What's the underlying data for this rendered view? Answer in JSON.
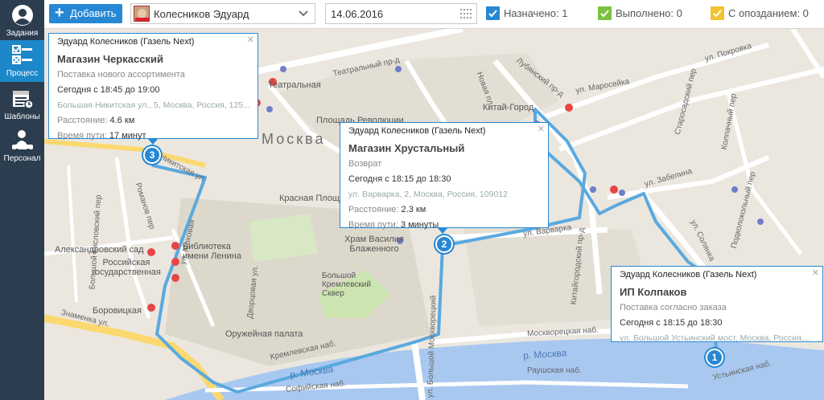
{
  "sidebar": {
    "items": [
      {
        "label": "Задания",
        "icon": "user-circle-icon"
      },
      {
        "label": "Процесс",
        "icon": "checklist-icon"
      },
      {
        "label": "Шаблоны",
        "icon": "calendar-list-icon"
      },
      {
        "label": "Персонал",
        "icon": "person-car-icon"
      }
    ]
  },
  "toolbar": {
    "add_label": "Добавить",
    "driver_name": "Колесников Эдуард",
    "date_value": "14.06.2016",
    "statuses": [
      {
        "label": "Назначено: 1",
        "color": "#2688d4"
      },
      {
        "label": "Выполнено: 0",
        "color": "#7cc142"
      },
      {
        "label": "С опозданием: 0",
        "color": "#f2c230"
      }
    ]
  },
  "map": {
    "labels": {
      "city": "Москва",
      "teatralny_pr": "Театральный пр-д",
      "teatralnaya": "Театральная",
      "ploshchad_revolyutsii": "Площадь Революции",
      "nikitskaya": "Никитская ул.",
      "mokhovaya": "ул. Моховая",
      "krasnaya_ploshchad": "Красная Площадь",
      "aleksandrovsky_sad": "Александровский сад",
      "rossiyskaya_gos": "Российская государственная",
      "biblioteka": "Библиотека имени Ленина",
      "borovitskaya": "Боровицкая",
      "znamenka": "Знаменка ул.",
      "khram": "Храм Василия Блаженного",
      "bolshoy_skver": "Большой Кремлевский Сквер",
      "oruzheynaya": "Оружейная палата",
      "kremlevskaya_nab": "Кремлевская наб.",
      "moskva_river": "р. Москва",
      "moskva_river2": "р. Москва",
      "sofiyskaya": "Софийская наб.",
      "moskvoretskaya": "Москворецкая наб.",
      "raushskaya": "Раушская наб.",
      "kitay_gorod": "Китай-Город",
      "lubyansky": "Лубянский пр-д",
      "maroseyka": "ул. Маросейка",
      "pokrovka": "ул. Покровка",
      "varvarka": "ул. Варварка",
      "zabelina": "ул. Забелина",
      "solyanka": "ул. Солянка",
      "ustinsky": "Устьинская наб.",
      "kitaygorodsky": "Китайгородский пр-д",
      "bolshoy_moskvoretsky": "ул. Большой Москворецкий",
      "novaya_pl": "Новая пл.",
      "romanov": "Романов пер",
      "bkislovsky": "Большой Кисловский пер",
      "kolpachny": "Колпачный пер",
      "podkolokolny": "Подколокольный пер",
      "starosadsky": "Старосадский пер",
      "dvortsovaya": "Дворцовая ул."
    },
    "stops": [
      {
        "number": "3",
        "driver": "Эдуард Колесников (Газель Next)",
        "title": "Магазин Черкасский",
        "type": "Поставка нового ассортимента",
        "time": "Сегодня с 18:45 до 19:00",
        "address": "Большая Никитская ул., 5, Москва, Россия, 125...",
        "distance_label": "Расстояние:",
        "distance": "4.6 км",
        "travel_label": "Время пути:",
        "travel": "17 минут"
      },
      {
        "number": "2",
        "driver": "Эдуард Колесников (Газель Next)",
        "title": "Магазин Хрустальный",
        "type": "Возврат",
        "time": "Сегодня с 18:15 до 18:30",
        "address": "ул. Варварка, 2, Москва, Россия, 109012",
        "distance_label": "Расстояние:",
        "distance": "2.3 км",
        "travel_label": "Время пути:",
        "travel": "3 минуты"
      },
      {
        "number": "1",
        "driver": "Эдуард Колесников (Газель Next)",
        "title": "ИП Колпаков",
        "type": "Поставка согласно заказа",
        "time": "Сегодня с 18:15 до 18:30",
        "address": "ул. Большой Устьинский мост, Москва, Россия,..."
      }
    ],
    "colors": {
      "route": "#5aa9df",
      "pin": "#2688d4",
      "river": "#a9c8f0",
      "park": "#cce5b0",
      "road": "#ffffff",
      "major_road": "#fbd970"
    }
  }
}
